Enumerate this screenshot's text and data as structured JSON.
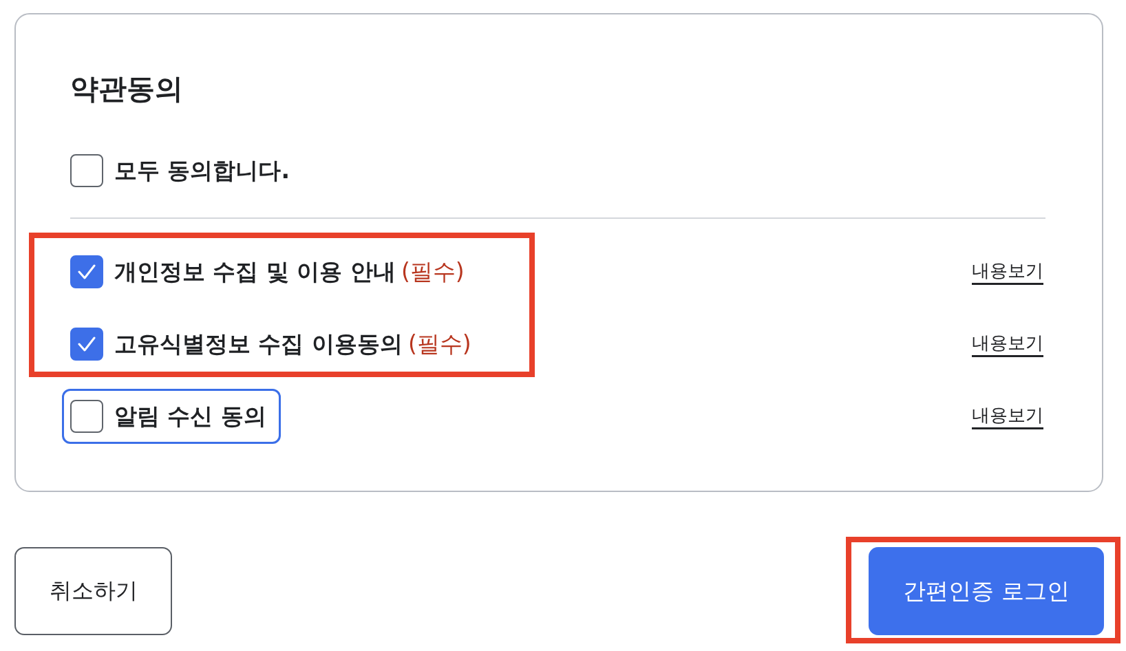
{
  "terms": {
    "title": "약관동의",
    "agree_all": {
      "label": "모두 동의합니다.",
      "checked": false,
      "focused": false
    },
    "groups": [
      {
        "highlighted": true,
        "items": [
          {
            "label": "개인정보 수집 및 이용 안내",
            "required_note": "(필수)",
            "checked": true,
            "focused": false,
            "link": "내용보기"
          },
          {
            "label": "고유식별정보 수집 이용동의",
            "required_note": "(필수)",
            "checked": true,
            "focused": false,
            "link": "내용보기"
          }
        ]
      },
      {
        "highlighted": false,
        "items": [
          {
            "label": "알림 수신 동의",
            "checked": false,
            "focused": true,
            "link": "내용보기"
          }
        ]
      }
    ]
  },
  "buttons": [
    {
      "kind": "secondary",
      "label": "취소하기",
      "highlighted": false
    },
    {
      "kind": "primary",
      "label": "간편인증 로그인",
      "highlighted": true
    }
  ]
}
